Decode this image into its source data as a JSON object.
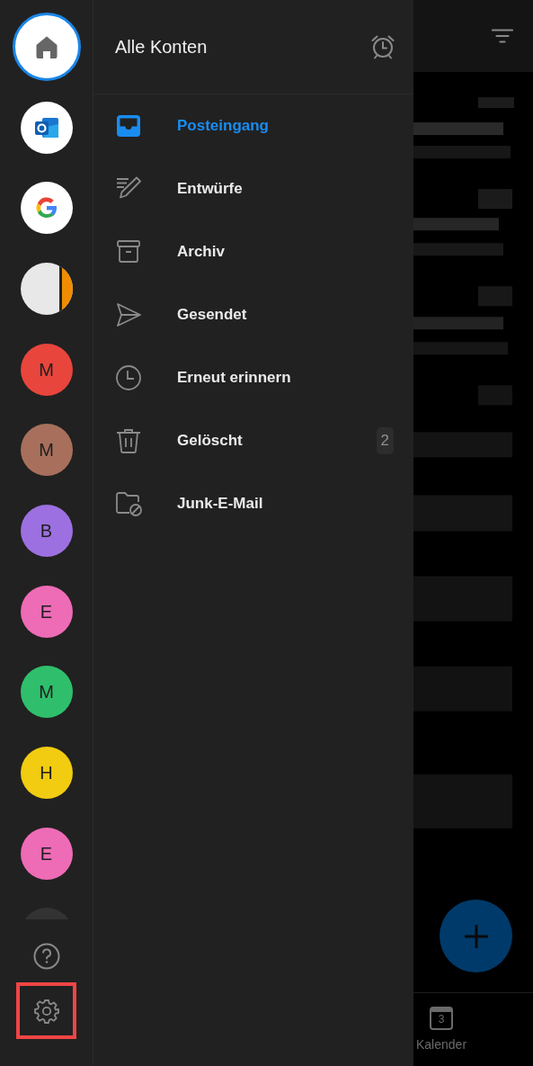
{
  "accounts": [
    {
      "kind": "home",
      "selected": true
    },
    {
      "kind": "outlook",
      "selected": false
    },
    {
      "kind": "google",
      "selected": false
    },
    {
      "kind": "split",
      "selected": false
    },
    {
      "kind": "letter",
      "initial": "M",
      "color": "#e8453c",
      "selected": false
    },
    {
      "kind": "letter",
      "initial": "M",
      "color": "#a8705c",
      "selected": false
    },
    {
      "kind": "letter",
      "initial": "B",
      "color": "#9c70e0",
      "selected": false
    },
    {
      "kind": "letter",
      "initial": "E",
      "color": "#ee6bb6",
      "selected": false
    },
    {
      "kind": "letter",
      "initial": "M",
      "color": "#2fbf6c",
      "selected": false
    },
    {
      "kind": "letter",
      "initial": "H",
      "color": "#f1cc10",
      "selected": false
    },
    {
      "kind": "letter",
      "initial": "E",
      "color": "#ee6bb6",
      "selected": false
    },
    {
      "kind": "plain",
      "color": "#333333",
      "selected": false
    }
  ],
  "rail_footer": {
    "settings_highlighted": true
  },
  "drawer": {
    "title": "Alle Konten",
    "folders": [
      {
        "kind": "inbox",
        "label": "Posteingang",
        "selected": true
      },
      {
        "kind": "drafts",
        "label": "Entwürfe",
        "selected": false
      },
      {
        "kind": "archive",
        "label": "Archiv",
        "selected": false
      },
      {
        "kind": "sent",
        "label": "Gesendet",
        "selected": false
      },
      {
        "kind": "snoozed",
        "label": "Erneut erinnern",
        "selected": false
      },
      {
        "kind": "deleted",
        "label": "Gelöscht",
        "count": "2",
        "selected": false
      },
      {
        "kind": "junk",
        "label": "Junk-E-Mail",
        "selected": false
      }
    ]
  },
  "bottom_nav": [
    {
      "kind": "calendar",
      "label": "Kalender",
      "icon_text": "3"
    }
  ]
}
